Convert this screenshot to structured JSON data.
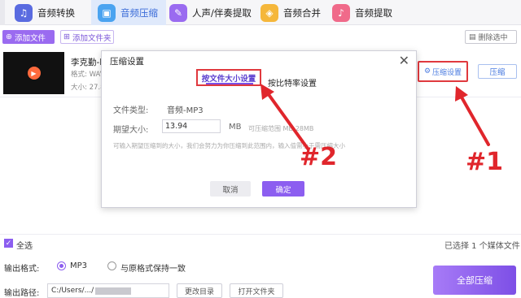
{
  "tabs": [
    {
      "label": "音频转换",
      "icon": "headphones-icon",
      "color": "#5a6be0"
    },
    {
      "label": "音频压缩",
      "icon": "compress-icon",
      "color": "#4aa3f0",
      "active": true
    },
    {
      "label": "人声/伴奏提取",
      "icon": "voice-icon",
      "color": "#9a6bf0"
    },
    {
      "label": "音频合并",
      "icon": "merge-icon",
      "color": "#f5b73b"
    },
    {
      "label": "音频提取",
      "icon": "mic-icon",
      "color": "#f06a8a"
    }
  ],
  "toolbar": {
    "add_file": "添加文件",
    "add_folder": "添加文件夹",
    "delete_selected": "删除选中"
  },
  "file": {
    "name": "李克勤-I",
    "format_label": "格式: WAV",
    "size_label": "大小: 27.8",
    "settings_button": "压缩设置",
    "compress_button": "压缩"
  },
  "dialog": {
    "title": "压缩设置",
    "tab_by_size": "按文件大小设置",
    "tab_by_bitrate": "按比特率设置",
    "file_type_label": "文件类型:",
    "file_type_value": "音频-MP3",
    "expected_size_label": "期望大小:",
    "expected_size_value": "13.94",
    "unit": "MB",
    "range_text": "可压缩范围  MB-28MB",
    "hint": "可输入期望压缩到的大小，我们会努力为你压缩到此范围内，输入值需小于需压缩大小",
    "cancel": "取消",
    "ok": "确定"
  },
  "annotations": {
    "label_1": "#1",
    "label_2": "#2",
    "color": "#e0262c"
  },
  "bottom": {
    "select_all": "全选",
    "selected_count": "已选择 1 个媒体文件",
    "output_format_label": "输出格式:",
    "format_mp3": "MP3",
    "format_same": "与原格式保持一致",
    "output_path_label": "输出路径:",
    "path_prefix": "C:/Users/.../",
    "change_dir": "更改目录",
    "open_folder": "打开文件夹",
    "compress_all": "全部压缩"
  }
}
